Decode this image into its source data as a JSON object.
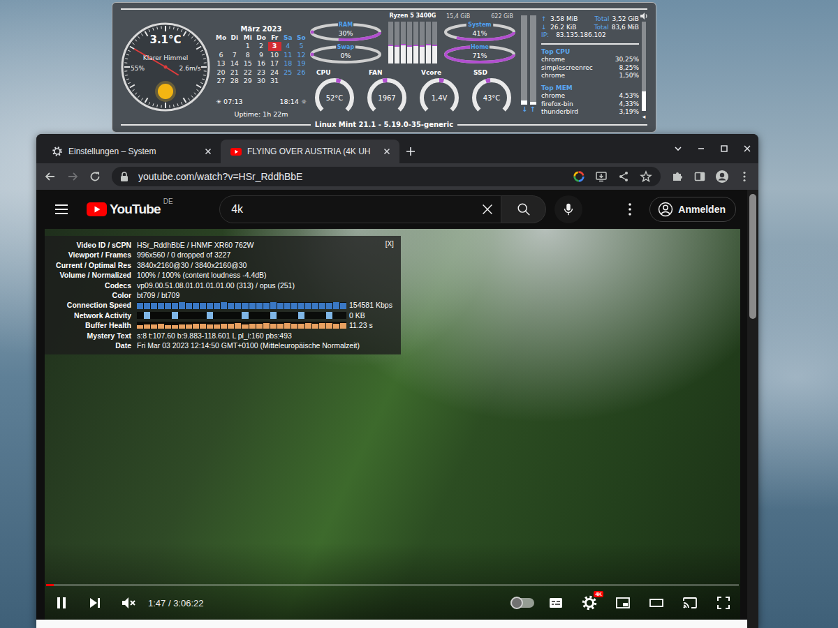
{
  "conky": {
    "weather": {
      "temperature": "3.1°C",
      "condition": "Klarer Himmel",
      "humidity": "55%",
      "wind": "2.6m/s",
      "needles": [
        {
          "kind": "long",
          "angle": 300
        },
        {
          "kind": "short",
          "angle": 122
        }
      ]
    },
    "calendar": {
      "month": "März 2023",
      "weekdays": [
        {
          "label": "Mo",
          "weekend": false
        },
        {
          "label": "Di",
          "weekend": false
        },
        {
          "label": "Mi",
          "weekend": false
        },
        {
          "label": "Do",
          "weekend": false
        },
        {
          "label": "Fr",
          "weekend": false
        },
        {
          "label": "Sa",
          "weekend": true
        },
        {
          "label": "So",
          "weekend": true
        }
      ],
      "weeks": [
        [
          {
            "d": "",
            "selected": false
          },
          {
            "d": "",
            "selected": false
          },
          {
            "d": "1",
            "selected": false
          },
          {
            "d": "2",
            "selected": false
          },
          {
            "d": "3",
            "selected": true
          },
          {
            "d": "4",
            "selected": false
          },
          {
            "d": "5",
            "selected": false
          }
        ],
        [
          {
            "d": "6",
            "selected": false
          },
          {
            "d": "7",
            "selected": false
          },
          {
            "d": "8",
            "selected": false
          },
          {
            "d": "9",
            "selected": false
          },
          {
            "d": "10",
            "selected": false
          },
          {
            "d": "11",
            "selected": false
          },
          {
            "d": "12",
            "selected": false
          }
        ],
        [
          {
            "d": "13",
            "selected": false
          },
          {
            "d": "14",
            "selected": false
          },
          {
            "d": "15",
            "selected": false
          },
          {
            "d": "16",
            "selected": false
          },
          {
            "d": "17",
            "selected": false
          },
          {
            "d": "18",
            "selected": false
          },
          {
            "d": "19",
            "selected": false
          }
        ],
        [
          {
            "d": "20",
            "selected": false
          },
          {
            "d": "21",
            "selected": false
          },
          {
            "d": "22",
            "selected": false
          },
          {
            "d": "23",
            "selected": false
          },
          {
            "d": "24",
            "selected": false
          },
          {
            "d": "25",
            "selected": false
          },
          {
            "d": "26",
            "selected": false
          }
        ],
        [
          {
            "d": "27",
            "selected": false
          },
          {
            "d": "28",
            "selected": false
          },
          {
            "d": "29",
            "selected": false
          },
          {
            "d": "30",
            "selected": false
          },
          {
            "d": "31",
            "selected": false
          },
          {
            "d": "",
            "selected": false
          },
          {
            "d": "",
            "selected": false
          }
        ]
      ]
    },
    "sun": {
      "rise_icon": "☀",
      "rise": "07:13",
      "set": "18:14",
      "set_icon": "☼"
    },
    "uptime": "Uptime: 1h 22m",
    "left_rings": [
      {
        "label": "RAM",
        "value": "30%",
        "level": 0.3
      },
      {
        "label": "Swap",
        "value": "0%",
        "level": 0
      }
    ],
    "right_rings": {
      "totals": [
        "15,4 GiB",
        "622 GiB"
      ],
      "rings": [
        {
          "label": "System",
          "value": "41%",
          "level": 0.41
        },
        {
          "label": "Home",
          "value": "71%",
          "level": 0.71
        }
      ]
    },
    "cpu": {
      "model": "Ryzen 5 3400G",
      "cores": [
        {
          "level": 0.45
        },
        {
          "level": 0.44
        },
        {
          "level": 0.46
        },
        {
          "level": 0.43
        },
        {
          "level": 0.45
        },
        {
          "level": 0.44
        },
        {
          "level": 0.46
        },
        {
          "level": 0.45
        }
      ]
    },
    "gauges": [
      {
        "label": "CPU",
        "value": "52°C",
        "level": 0.52
      },
      {
        "label": "FAN",
        "value": "1967",
        "level": 0.45
      },
      {
        "label": "Vcore",
        "value": "1,4V",
        "level": 0.5
      },
      {
        "label": "SSD",
        "value": "43°C",
        "level": 0.43
      }
    ],
    "network": {
      "graphs": [
        {
          "arrow": "↓",
          "level": 0.05
        },
        {
          "arrow": "↑",
          "level": 0.03
        }
      ],
      "lines": [
        {
          "arrow": "↑",
          "rate": "3.58 MiB",
          "total_label": "Total",
          "total": "3,52 GiB"
        },
        {
          "arrow": "↓",
          "rate": "26.2 KiB",
          "total_label": "Total",
          "total": "83,6 MiB"
        }
      ],
      "ip_label": "IP:",
      "ip": "83.135.186.102"
    },
    "top_lists": [
      {
        "title": "Top CPU",
        "rows": [
          {
            "name": "chrome",
            "value": "30,25%"
          },
          {
            "name": "simplescreenrec",
            "value": "8,25%"
          },
          {
            "name": "chrome",
            "value": "1,50%"
          }
        ]
      },
      {
        "title": "Top MEM",
        "rows": [
          {
            "name": "chrome",
            "value": "4,53%"
          },
          {
            "name": "firefox-bin",
            "value": "4,33%"
          },
          {
            "name": "thunderbird",
            "value": "3,19%"
          }
        ]
      }
    ],
    "volume": {
      "level": 0.22,
      "marker": "◂"
    },
    "footer": "Linux Mint 21.1 - 5.19.0-35-generic"
  },
  "browser": {
    "tabs": [
      {
        "kind": "settings",
        "label": "Einstellungen – System",
        "selected": false
      },
      {
        "kind": "youtube",
        "label": "FLYING OVER AUSTRIA (4K UH",
        "selected": true
      }
    ],
    "nav": {
      "back_enabled": true,
      "forward_enabled": false
    },
    "address": "youtube.com/watch?v=HSr_RddhBbE",
    "youtube": {
      "logo": "YouTube",
      "region": "DE",
      "search": "4k",
      "sign_in": "Anmelden"
    },
    "stats": {
      "close": "[X]",
      "rows": [
        {
          "label": "Video ID / sCPN",
          "kind": "text",
          "value": "HSr_RddhBbE / HNMF XR60 762W"
        },
        {
          "label": "Viewport / Frames",
          "kind": "text",
          "value": "996x560 / 0 dropped of 3227"
        },
        {
          "label": "Current / Optimal Res",
          "kind": "text",
          "value": "3840x2160@30 / 3840x2160@30"
        },
        {
          "label": "Volume / Normalized",
          "kind": "text",
          "value": "100% / 100% (content loudness -4.4dB)"
        },
        {
          "label": "Codecs",
          "kind": "text",
          "value": "vp09.00.51.08.01.01.01.01.00 (313) / opus (251)"
        },
        {
          "label": "Color",
          "kind": "text",
          "value": "bt709 / bt709"
        },
        {
          "label": "Connection Speed",
          "kind": "graph",
          "value": "154581 Kbps",
          "color": "#3a78c4",
          "series": [
            0.88,
            0.9,
            0.9,
            0.86,
            0.88,
            0.9,
            0.92,
            0.9,
            0.86,
            0.88,
            0.9,
            0.9,
            0.92,
            0.88,
            0.86,
            0.9,
            0.9,
            0.88,
            0.9,
            0.92,
            0.9,
            0.88,
            0.86,
            0.9,
            0.9,
            0.88,
            0.9,
            0.9,
            0.92,
            0.9
          ]
        },
        {
          "label": "Network Activity",
          "kind": "graph",
          "value": "0 KB",
          "color": "#7fb6e6",
          "series": [
            0,
            1,
            0,
            0,
            0,
            1,
            0,
            0,
            0,
            0,
            1,
            0,
            0,
            0,
            0,
            1,
            0,
            0,
            0,
            1,
            0,
            0,
            0,
            1,
            0,
            0,
            0,
            1,
            0,
            0
          ]
        },
        {
          "label": "Buffer Health",
          "kind": "graph",
          "value": "11.23 s",
          "color": "#e8a060",
          "series": [
            0.55,
            0.6,
            0.65,
            0.7,
            0.5,
            0.55,
            0.6,
            0.65,
            0.7,
            0.75,
            0.6,
            0.65,
            0.7,
            0.75,
            0.8,
            0.65,
            0.7,
            0.75,
            0.8,
            0.7,
            0.75,
            0.8,
            0.7,
            0.75,
            0.8,
            0.75,
            0.8,
            0.8,
            0.78,
            0.8
          ]
        },
        {
          "label": "Mystery Text",
          "kind": "text",
          "value": "s:8 t:107.60 b:9.883-118.601 L pl_i:160 pbs:493"
        },
        {
          "label": "Date",
          "kind": "text",
          "value": "Fri Mar 03 2023 12:14:50 GMT+0100 (Mitteleuropäische Normalzeit)"
        }
      ]
    },
    "player": {
      "playing": true,
      "muted": true,
      "time": "1:47 / 3:06:22",
      "progress": 0.011,
      "autoplay": false,
      "quality_badge": "4K"
    },
    "scrollbar": {
      "position": 0,
      "size": 0.29
    }
  }
}
